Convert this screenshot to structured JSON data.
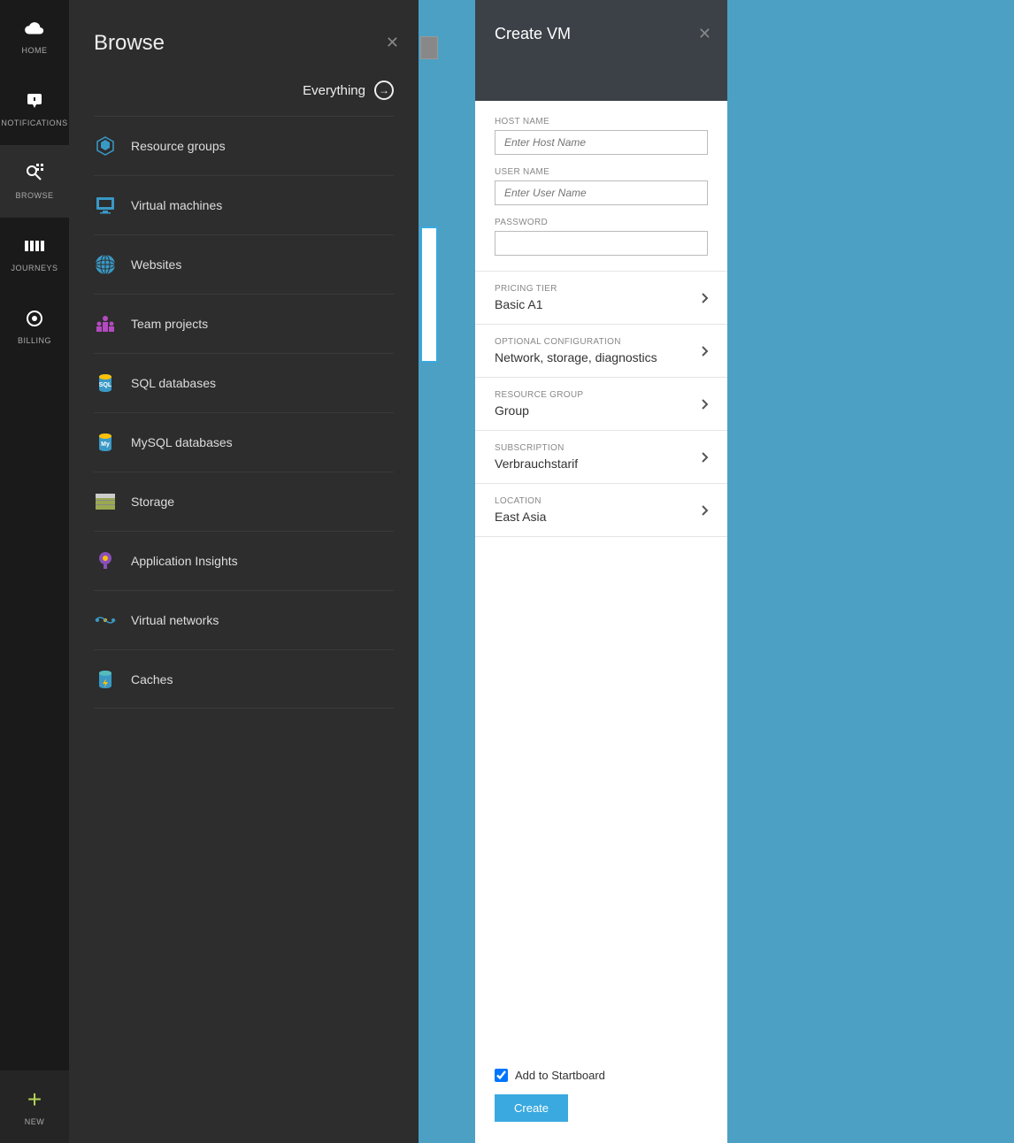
{
  "leftNav": {
    "items": [
      {
        "label": "HOME",
        "icon": "cloud"
      },
      {
        "label": "NOTIFICATIONS",
        "icon": "notification"
      },
      {
        "label": "BROWSE",
        "icon": "browse"
      },
      {
        "label": "JOURNEYS",
        "icon": "journeys"
      },
      {
        "label": "BILLING",
        "icon": "billing"
      }
    ],
    "new_label": "NEW"
  },
  "browse": {
    "title": "Browse",
    "everything": "Everything",
    "items": [
      {
        "label": "Resource groups",
        "icon": "resource-groups"
      },
      {
        "label": "Virtual machines",
        "icon": "vm"
      },
      {
        "label": "Websites",
        "icon": "websites"
      },
      {
        "label": "Team projects",
        "icon": "team"
      },
      {
        "label": "SQL databases",
        "icon": "sql"
      },
      {
        "label": "MySQL databases",
        "icon": "mysql"
      },
      {
        "label": "Storage",
        "icon": "storage"
      },
      {
        "label": "Application Insights",
        "icon": "insights"
      },
      {
        "label": "Virtual networks",
        "icon": "vnet"
      },
      {
        "label": "Caches",
        "icon": "cache"
      }
    ]
  },
  "createVm": {
    "title": "Create VM",
    "hostname_label": "HOST NAME",
    "hostname_placeholder": "Enter Host Name",
    "username_label": "USER NAME",
    "username_placeholder": "Enter User Name",
    "password_label": "PASSWORD",
    "sections": [
      {
        "label": "PRICING TIER",
        "value": "Basic A1"
      },
      {
        "label": "OPTIONAL CONFIGURATION",
        "value": "Network, storage, diagnostics"
      },
      {
        "label": "RESOURCE GROUP",
        "value": "Group"
      },
      {
        "label": "SUBSCRIPTION",
        "value": "Verbrauchstarif"
      },
      {
        "label": "LOCATION",
        "value": "East Asia"
      }
    ],
    "startboard_label": "Add to Startboard",
    "startboard_checked": true,
    "create_button": "Create"
  }
}
